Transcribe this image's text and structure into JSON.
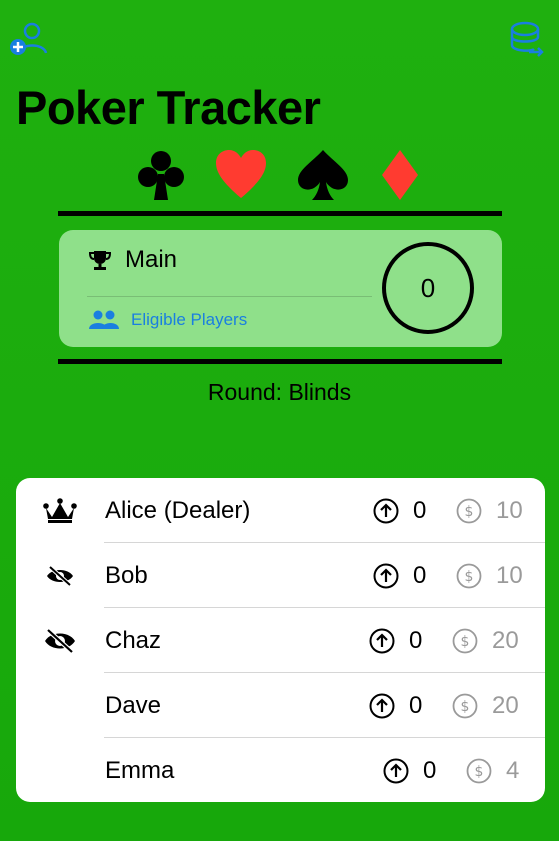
{
  "app": {
    "title": "Poker Tracker"
  },
  "toolbar": {
    "add_player_icon": "person-add-icon",
    "chips_icon": "chips-stack-icon",
    "accent_color": "#1a7fe0"
  },
  "suits": [
    {
      "name": "club",
      "color": "#000000"
    },
    {
      "name": "heart",
      "color": "#ff3b30"
    },
    {
      "name": "spade",
      "color": "#000000"
    },
    {
      "name": "diamond",
      "color": "#ff3b30"
    }
  ],
  "pot": {
    "name": "Main",
    "eligible_label": "Eligible Players",
    "amount": "0"
  },
  "round": {
    "label": "Round: Blinds"
  },
  "players": [
    {
      "name": "Alice (Dealer)",
      "status_icon": "crown-icon",
      "bet": "0",
      "stack": "10"
    },
    {
      "name": "Bob",
      "status_icon": "eye-slash-icon",
      "bet": "0",
      "stack": "10"
    },
    {
      "name": "Chaz",
      "status_icon": "eye-slash-icon",
      "bet": "0",
      "stack": "20"
    },
    {
      "name": "Dave",
      "status_icon": "",
      "bet": "0",
      "stack": "20"
    },
    {
      "name": "Emma",
      "status_icon": "",
      "bet": "0",
      "stack": "4"
    }
  ]
}
